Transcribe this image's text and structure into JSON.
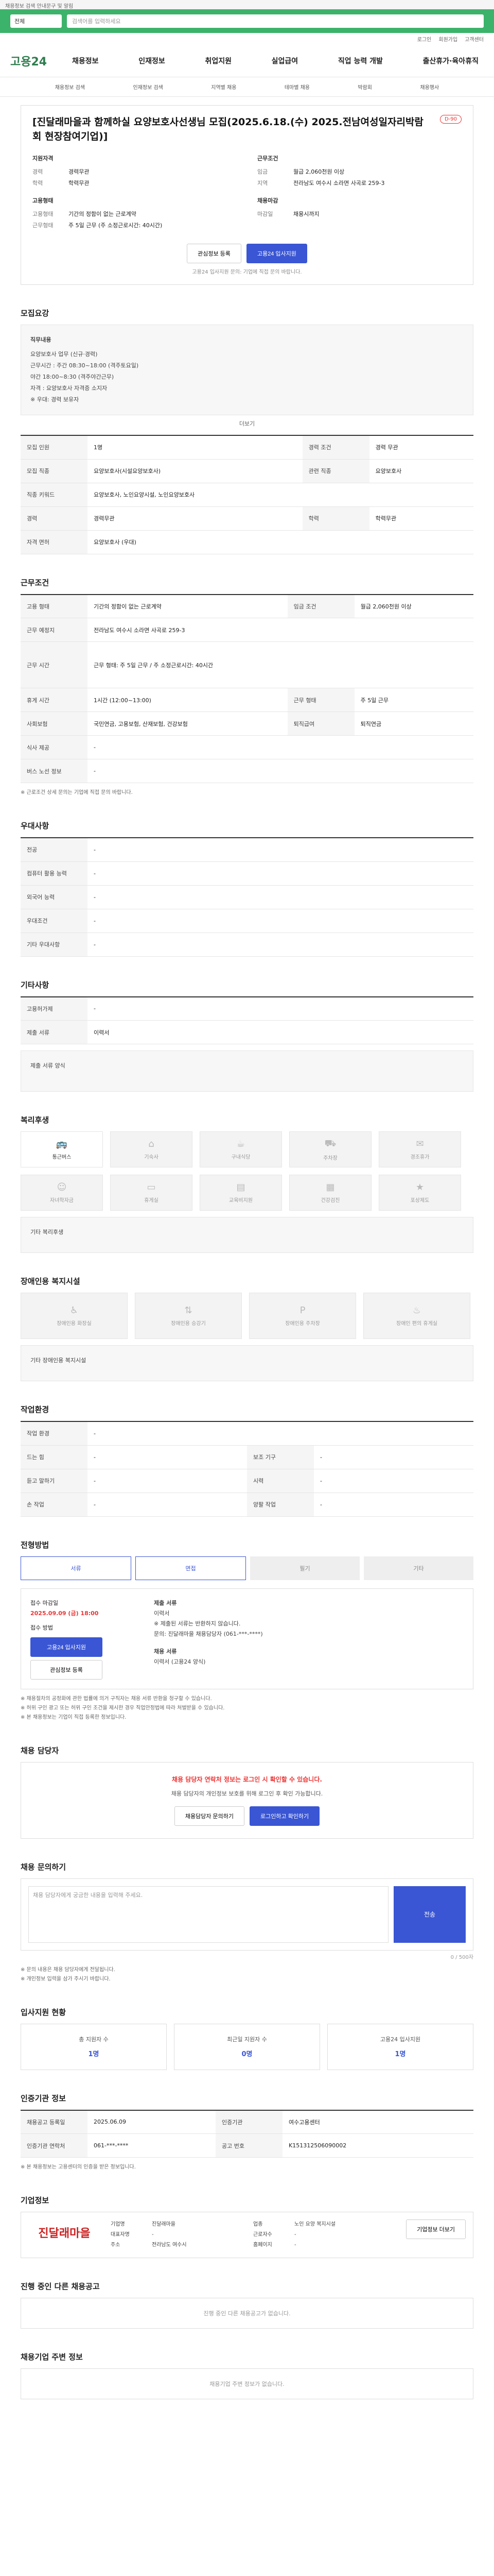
{
  "top_notice": "채용정보 검색 안내문구 및 알림",
  "search": {
    "select": "전체",
    "placeholder": "검색어를 입력하세요"
  },
  "util_links": [
    "로그인",
    "회원가입",
    "고객센터"
  ],
  "logo": "고용24",
  "main_menu": [
    "채용정보",
    "인재정보",
    "취업지원",
    "실업급여",
    "직업 능력 개발",
    "출산휴가·육아휴직"
  ],
  "sub_menu": [
    "채용정보 검색",
    "인재정보 검색",
    "지역별 채용",
    "테마별 채용",
    "박람회",
    "채용행사"
  ],
  "job": {
    "title": "[진달래마을과 함께하실 요양보호사선생님 모집(2025.6.18.(수) 2025.전남여성일자리박람회 현장참여기업)]",
    "dday": "D-90",
    "left_heading": "지원자격",
    "left": [
      {
        "k": "경력",
        "v": "경력무관"
      },
      {
        "k": "학력",
        "v": "학력무관"
      }
    ],
    "left_heading2": "고용형태",
    "left2": [
      {
        "k": "고용형태",
        "v": "기간의 정함이 없는 근로계약"
      },
      {
        "k": "근무형태",
        "v": "주 5일 근무 (주 소정근로시간: 40시간)"
      }
    ],
    "right_heading": "근무조건",
    "right": [
      {
        "k": "임금",
        "v": "월급 2,060천원 이상"
      },
      {
        "k": "지역",
        "v": "전라남도 여수시 소라면 사곡로 259-3"
      }
    ],
    "right_heading2": "채용마감",
    "right2": [
      {
        "k": "마감일",
        "v": "채용시까지"
      }
    ],
    "btn_scrap": "관심정보 등록",
    "btn_apply": "고용24 입사지원",
    "apply_note": "고용24 입사지원 문의: 기업에 직접 문의 바랍니다."
  },
  "sections": {
    "recruit": "모집요강",
    "work": "근무조건",
    "welfare_extra": "우대사항",
    "etc": "기타사항",
    "welfare": "복리후생",
    "disabled": "장애인용 복지시설",
    "env": "작업환경",
    "process": "전형방법",
    "contact": "채용 담당자",
    "qa": "채용 문의하기",
    "stats": "입사지원 현황",
    "origin": "인증기관 정보",
    "company": "기업정보",
    "other_jobs": "진행 중인 다른 채용공고",
    "neighbors": "채용기업 주변 정보"
  },
  "recruit_box": {
    "title": "직무내용",
    "lines": [
      "요양보호사 업무 (신규·경력)",
      "근무시간 : 주간 08:30~18:00 (격주토요일)",
      "야간 18:00~8:30 (격주야간근무)",
      "자격 : 요양보호사 자격증 소지자",
      "※ 우대: 경력 보유자"
    ],
    "more": "더보기"
  },
  "recruit_table": [
    {
      "k": "모집 인원",
      "v": "1명",
      "k2": "경력 조건",
      "v2": "경력 무관"
    },
    {
      "k": "모집 직종",
      "v": "요양보호사(시설요양보호사)",
      "k2": "관련 직종",
      "v2": "요양보호사"
    },
    {
      "k": "직종 키워드",
      "v": "요양보호사, 노인요양시설, 노인요양보호사",
      "k2": "",
      "v2": ""
    },
    {
      "k": "경력",
      "v": "경력무관",
      "k2": "학력",
      "v2": "학력무관"
    },
    {
      "k": "자격 면허",
      "v": "요양보호사 (우대)",
      "k2": "",
      "v2": ""
    }
  ],
  "work_table": [
    {
      "k": "고용 형태",
      "v": "기간의 정함이 없는 근로계약",
      "k2": "임금 조건",
      "v2": "월급 2,060천원 이상"
    },
    {
      "k": "근무 예정지",
      "v": "전라남도 여수시 소라면 사곡로 259-3",
      "k2": "",
      "v2": ""
    },
    {
      "k": "근무 시간",
      "v": "근무 형태: 주 5일 근무 / 주 소정근로시간: 40시간",
      "k2": "",
      "v2": ""
    },
    {
      "k": "휴게 시간",
      "v": "1시간 (12:00~13:00)",
      "k2": "근무 형태",
      "v2": "주 5일 근무"
    },
    {
      "k": "사회보험",
      "v": "국민연금, 고용보험, 산재보험, 건강보험",
      "k2": "퇴직급여",
      "v2": "퇴직연금"
    },
    {
      "k": "식사 제공",
      "v": "-",
      "k2": "",
      "v2": ""
    },
    {
      "k": "버스 노선 정보",
      "v": "-",
      "k2": "",
      "v2": ""
    }
  ],
  "work_note": "※ 근로조건 상세 문의는 기업에 직접 문의 바랍니다.",
  "pref_table": [
    {
      "k": "전공",
      "v": "-"
    },
    {
      "k": "컴퓨터 활용 능력",
      "v": "-"
    },
    {
      "k": "외국어 능력",
      "v": "-"
    },
    {
      "k": "우대조건",
      "v": "-"
    },
    {
      "k": "기타 우대사항",
      "v": "-"
    }
  ],
  "etc_table": [
    {
      "k": "고용허가제",
      "v": "-"
    },
    {
      "k": "제출 서류",
      "v": "이력서"
    }
  ],
  "etc_link": "제출 서류 양식",
  "welfare_items": [
    {
      "icon": "bus-icon",
      "label": "통근버스",
      "on": true
    },
    {
      "icon": "home-icon",
      "label": "기숙사",
      "on": false
    },
    {
      "icon": "meal-icon",
      "label": "구내식당",
      "on": false
    },
    {
      "icon": "car-icon",
      "label": "주차장",
      "on": false
    },
    {
      "icon": "gift-icon",
      "label": "경조휴가",
      "on": false
    },
    {
      "icon": "child-icon",
      "label": "자녀학자금",
      "on": false
    },
    {
      "icon": "bed-icon",
      "label": "휴게실",
      "on": false
    },
    {
      "icon": "book-icon",
      "label": "교육비지원",
      "on": false
    },
    {
      "icon": "doc-icon",
      "label": "건강검진",
      "on": false
    },
    {
      "icon": "star-icon",
      "label": "포상제도",
      "on": false
    }
  ],
  "welfare_etc": "기타 복리후생",
  "disabled_items": [
    {
      "label": "장애인용 화장실",
      "on": false
    },
    {
      "label": "장애인용 승강기",
      "on": false
    },
    {
      "label": "장애인용 주차장",
      "on": false
    },
    {
      "label": "장애인 편의 휴게실",
      "on": false
    }
  ],
  "disabled_etc": "기타 장애인용 복지시설",
  "env_table": [
    {
      "k": "작업 환경",
      "v": "-",
      "k2": "",
      "v2": ""
    },
    {
      "k": "드는 힘",
      "v": "-",
      "k2": "보조 기구",
      "v2": "-"
    },
    {
      "k": "듣고 말하기",
      "v": "-",
      "k2": "시력",
      "v2": "-"
    },
    {
      "k": "손 작업",
      "v": "-",
      "k2": "양팔 작업",
      "v2": "-"
    }
  ],
  "process_steps": [
    {
      "label": "서류",
      "on": true
    },
    {
      "label": "면접",
      "on": true
    },
    {
      "label": "필기",
      "on": false
    },
    {
      "label": "기타",
      "on": false
    }
  ],
  "apply": {
    "period_label": "접수 마감일",
    "deadline": "2025.09.09 (금) 18:00",
    "method_label": "접수 방법",
    "btn_apply": "고용24 입사지원",
    "btn_scrap": "관심정보 등록",
    "right_title": "제출 서류",
    "right_lines": [
      "이력서",
      "※ 제출된 서류는 반환하지 않습니다.",
      "문의: 진달래마을 채용담당자 (061-***-****)"
    ],
    "method_title": "채용 서류",
    "method_value": "이력서 (고용24 양식)"
  },
  "apply_notes": [
    "※ 채용절차의 공정화에 관한 법률에 의거 구직자는 채용 서류 반환을 청구할 수 있습니다.",
    "※ 허위 구인 광고 또는 허위 구인 조건을 제시한 경우 직업안정법에 따라 처벌받을 수 있습니다.",
    "※ 본 채용정보는 기업이 직접 등록한 정보입니다."
  ],
  "contact_box": {
    "alert": "채용 담당자 연락처 정보는 로그인 시 확인할 수 있습니다.",
    "desc": "채용 담당자의 개인정보 보호를 위해 로그인 후 확인 가능합니다.",
    "btn_scrap": "채용담당자 문의하기",
    "btn_apply": "로그인하고 확인하기"
  },
  "qa": {
    "placeholder": "채용 담당자에게 궁금한 내용을 입력해 주세요.",
    "counter": "0 / 500자",
    "send": "전송",
    "notes": [
      "※ 문의 내용은 채용 담당자에게 전달됩니다.",
      "※ 개인정보 입력을 삼가 주시기 바랍니다."
    ]
  },
  "stats": [
    {
      "label": "총 지원자 수",
      "value": "1명"
    },
    {
      "label": "최근일 지원자 수",
      "value": "0명"
    },
    {
      "label": "고용24 입사지원",
      "value": "1명"
    }
  ],
  "stats_more": "더보기",
  "origin_table": [
    {
      "k": "채용공고 등록일",
      "v": "2025.06.09",
      "k2": "인증기관",
      "v2": "여수고용센터"
    },
    {
      "k": "인증기관 연락처",
      "v": "061-***-****",
      "k2": "공고 번호",
      "v2": "K151312506090002"
    }
  ],
  "origin_note": "※ 본 채용정보는 고용센터의 인증을 받은 정보입니다.",
  "company": {
    "logo_text": "진달래마을",
    "rows": [
      {
        "k": "기업명",
        "v": "진달래마을",
        "k2": "업종",
        "v2": "노인 요양 복지시설"
      },
      {
        "k": "대표자명",
        "v": "-",
        "k2": "근로자수",
        "v2": "-"
      },
      {
        "k": "주소",
        "v": "전라남도 여수시",
        "k2": "홈페이지",
        "v2": "-"
      }
    ],
    "btn_more": "기업정보 더보기"
  },
  "other_jobs_empty": "진행 중인 다른 채용공고가 없습니다.",
  "neighbors_empty": "채용기업 주변 정보가 없습니다."
}
